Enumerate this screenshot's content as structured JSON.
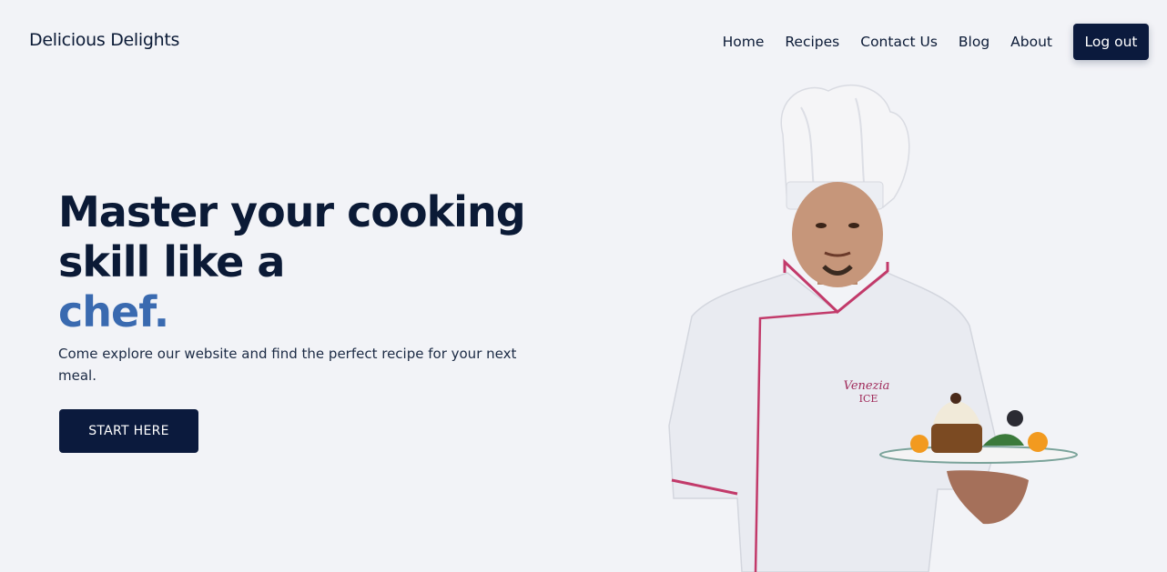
{
  "header": {
    "brand": "Delicious Delights",
    "nav": [
      "Home",
      "Recipes",
      "Contact Us",
      "Blog",
      "About"
    ],
    "logout_label": "Log out"
  },
  "hero": {
    "title_line1": "Master your cooking",
    "title_line2": "skill like a",
    "title_accent": "chef.",
    "subtitle": "Come explore our website and find the perfect recipe for your next meal.",
    "cta_label": "START HERE"
  },
  "colors": {
    "background": "#f2f3f7",
    "primary_dark": "#0b1a3d",
    "accent_blue": "#3a6ab0",
    "jacket_trim": "#c23a6a"
  },
  "image": {
    "subject": "chef-holding-dessert-plate"
  }
}
